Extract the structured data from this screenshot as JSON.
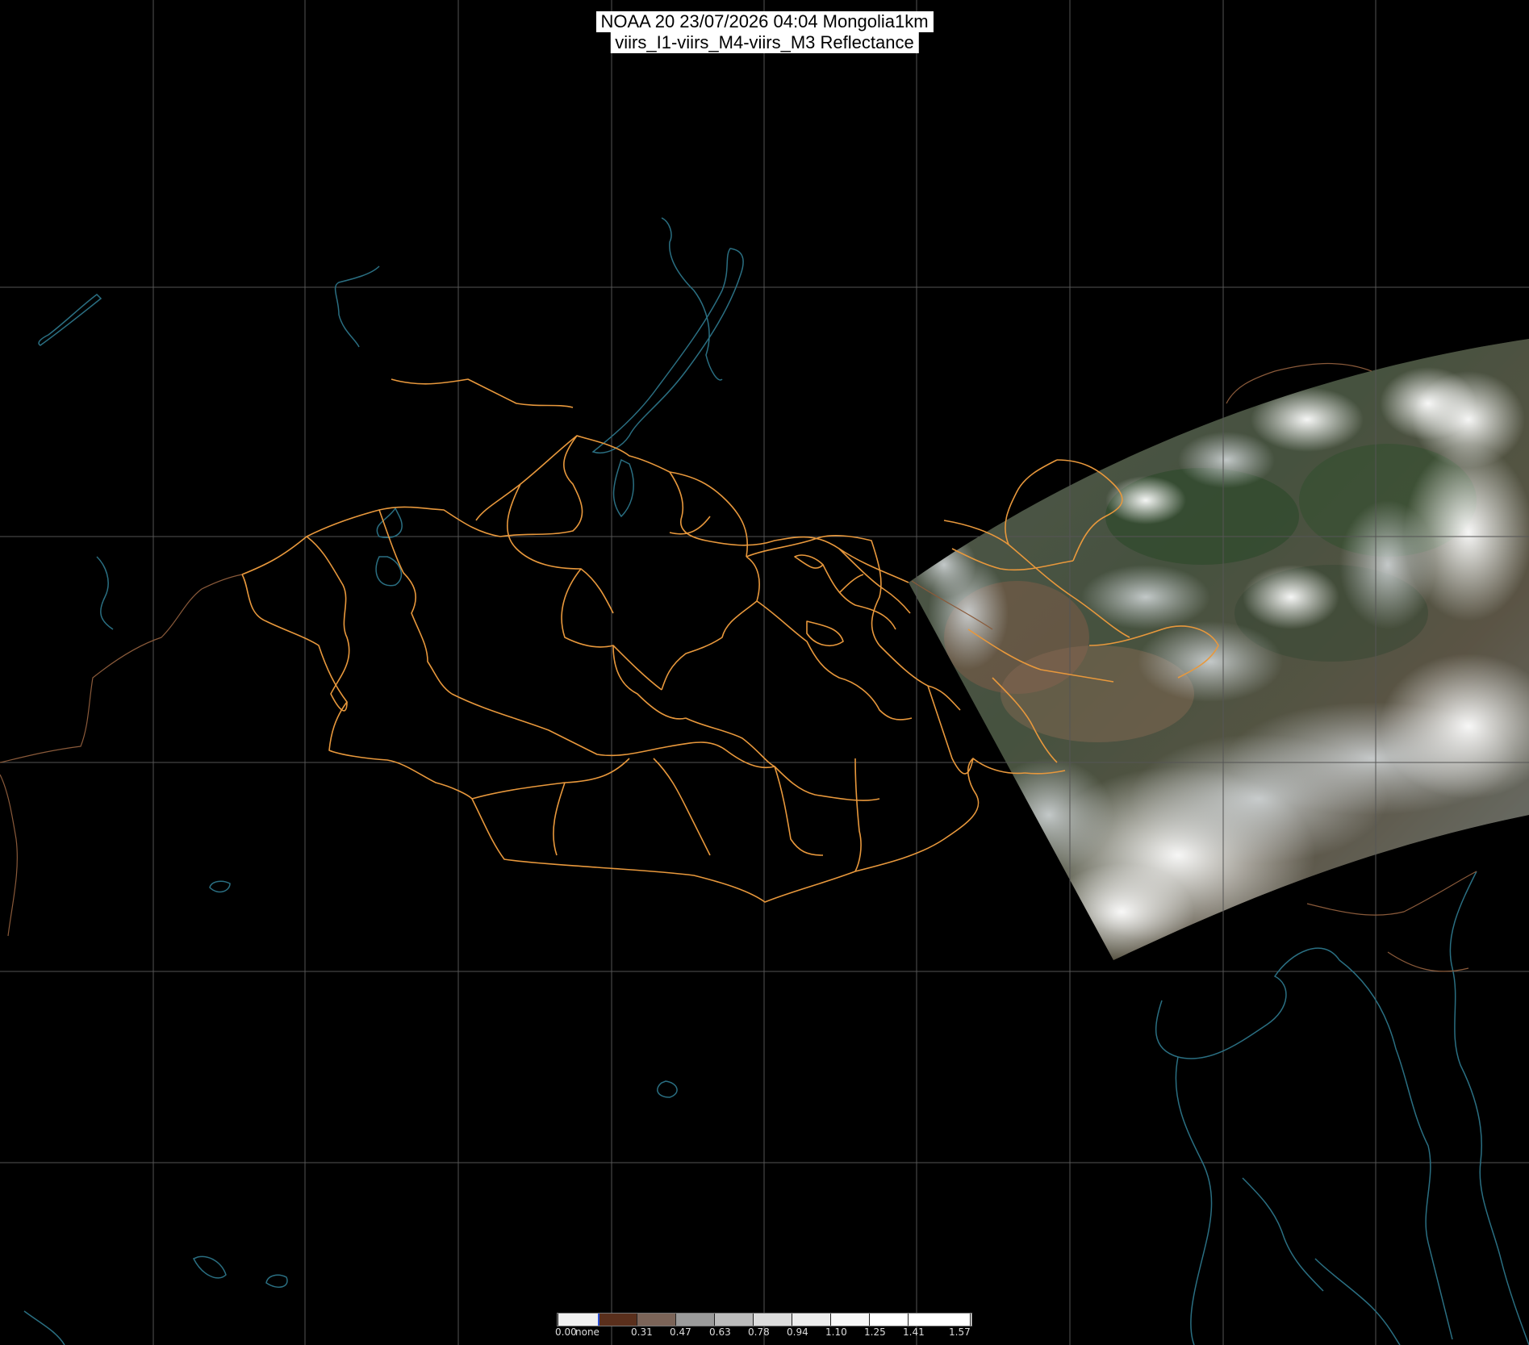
{
  "title": {
    "line1": "NOAA 20 23/07/2026 04:04 Mongolia1km",
    "line2": "viirs_I1-viirs_M4-viirs_M3 Reflectance"
  },
  "map": {
    "background": "#000000",
    "grid_color": "#555555",
    "border_color": "#e8983c",
    "coast_color": "#2a6f82",
    "swath": "satellite reflectance swath over eastern Mongolia and north-eastern China, clouds in white"
  },
  "colorbar": {
    "label_start": "0.00",
    "label_none": "none",
    "ticks": [
      "0.31",
      "0.47",
      "0.63",
      "0.78",
      "0.94",
      "1.10",
      "1.25",
      "1.41",
      "1.57"
    ],
    "colors": [
      "#f0f0f0",
      "#5a2f1c",
      "#7b6458",
      "#9a9a9a",
      "#bcbcbc",
      "#dcdcdc",
      "#ededed",
      "#f8f8f8",
      "#ffffff",
      "#ffffff"
    ]
  }
}
